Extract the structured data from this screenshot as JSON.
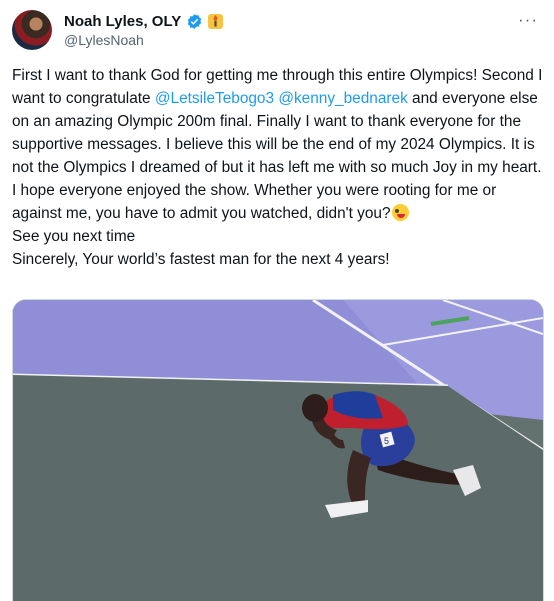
{
  "author": {
    "display_name": "Noah Lyles, OLY",
    "handle": "@LylesNoah",
    "verified_icon": "verified-badge-icon",
    "flag_icon": "olympic-torch-icon",
    "more_label": "···"
  },
  "tweet": {
    "line1": "First I want to thank God for getting me through this entire Olympics! Second I want to congratulate ",
    "mention1": "@LetsileTebogo3",
    "space": " ",
    "mention2": "@kenny_bednarek",
    "line2": " and everyone else on an amazing Olympic 200m final. Finally I want to thank everyone for the supportive messages. I believe this will be the end of my 2024 Olympics. It is not the Olympics I dreamed of but it has left me with so much Joy in my heart. I hope everyone enjoyed the show. Whether you were rooting for me or against me, you have to admit you watched, didn't you?",
    "emoji_name": "zany-face-emoji",
    "line3": "\nSee you next time\nSincerely, Your world’s fastest man for the next 4 years!"
  },
  "media": {
    "image_subject": "athlete-kneeling-on-track",
    "bib_number": "5"
  },
  "colors": {
    "link": "#1d9bf0",
    "secondary_text": "#536471",
    "track_lane": "#8f8ed6",
    "infield": "#5f6f6e",
    "verified": "#1d9bf0"
  }
}
